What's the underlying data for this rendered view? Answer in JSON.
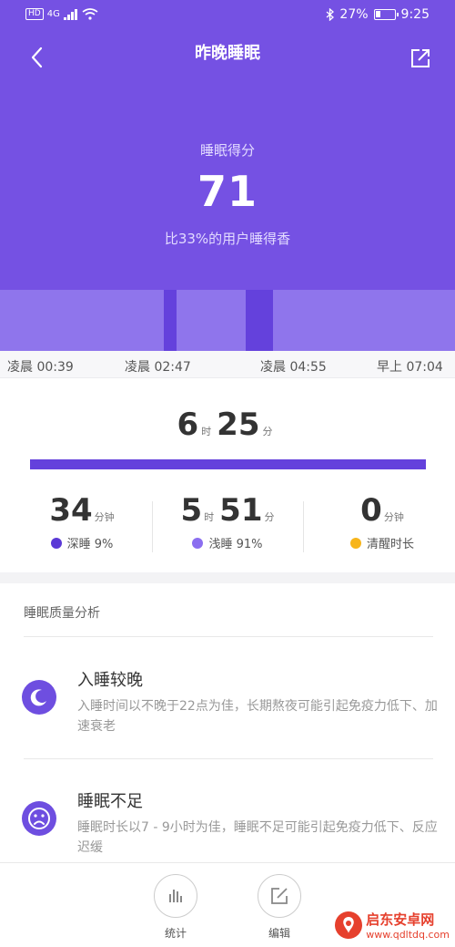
{
  "status_bar": {
    "hd": "HD",
    "network": "4G",
    "battery_text": "27%",
    "battery_level": 0.27,
    "time": "9:25"
  },
  "nav": {
    "title": "昨晚睡眠",
    "back_icon": "chevron-left-icon",
    "share_icon": "share-out-icon"
  },
  "score": {
    "label": "睡眠得分",
    "value": "71",
    "compare": "比33%的用户睡得香"
  },
  "timeline": {
    "labels": [
      "凌晨 00:39",
      "凌晨 02:47",
      "凌晨 04:55",
      "早上 07:04"
    ]
  },
  "duration": {
    "hours": "6",
    "hours_unit": "时",
    "minutes": "25",
    "minutes_unit": "分"
  },
  "stats": [
    {
      "value": "34",
      "unit": "分钟",
      "label": "深睡 9%",
      "color": "#5b39d6"
    },
    {
      "hours": "5",
      "hours_unit": "时",
      "minutes": "51",
      "minutes_unit": "分",
      "label": "浅睡 91%",
      "color": "#8b6ef0"
    },
    {
      "value": "0",
      "unit": "分钟",
      "label": "清醒时长",
      "color": "#f7b51b"
    }
  ],
  "analysis": {
    "title": "睡眠质量分析",
    "items": [
      {
        "icon": "moon-icon",
        "title": "入睡较晚",
        "desc": "入睡时间以不晚于22点为佳，长期熬夜可能引起免疫力低下、加速衰老"
      },
      {
        "icon": "sad-face-icon",
        "title": "睡眠不足",
        "desc": "睡眠时长以7 - 9小时为佳，睡眠不足可能引起免疫力低下、反应迟缓"
      }
    ]
  },
  "bottom_bar": {
    "stats_label": "统计",
    "edit_label": "编辑"
  },
  "watermark": {
    "name": "启东安卓网",
    "url": "www.qdltdq.com"
  },
  "colors": {
    "header": "#7551e3",
    "deep_sleep": "#6441dc",
    "light_sleep": "#8f75ec"
  }
}
